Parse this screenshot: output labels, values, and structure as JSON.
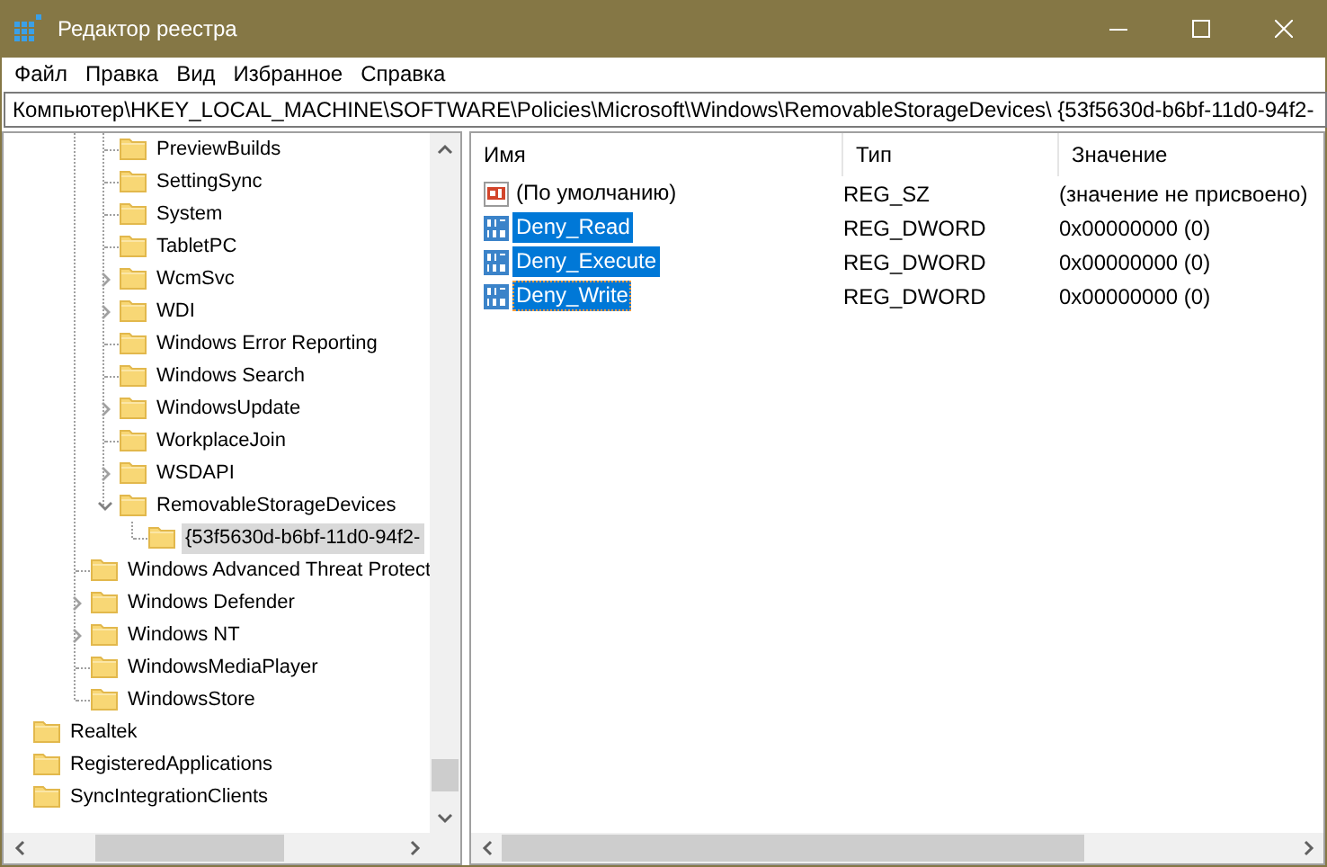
{
  "window": {
    "title": "Редактор реестра"
  },
  "menu": [
    "Файл",
    "Правка",
    "Вид",
    "Избранное",
    "Справка"
  ],
  "address": "Компьютер\\HKEY_LOCAL_MACHINE\\SOFTWARE\\Policies\\Microsoft\\Windows\\RemovableStorageDevices\\ {53f5630d-b6bf-11d0-94f2-",
  "tree": {
    "items": [
      {
        "children": [
          {
            "children": [
              {
                "children": [
                  {
                    "label": "PreviewBuilds",
                    "selected": false
                  },
                  {
                    "label": "SettingSync",
                    "selected": false
                  },
                  {
                    "label": "System",
                    "selected": false
                  },
                  {
                    "label": "TabletPC",
                    "selected": false
                  },
                  {
                    "label": "WcmSvc",
                    "selected": false,
                    "expanded": false
                  },
                  {
                    "label": "WDI",
                    "selected": false,
                    "expanded": false
                  },
                  {
                    "label": "Windows Error Reporting",
                    "selected": false
                  },
                  {
                    "label": "Windows Search",
                    "selected": false
                  },
                  {
                    "label": "WindowsUpdate",
                    "selected": false,
                    "expanded": false
                  },
                  {
                    "label": "WorkplaceJoin",
                    "selected": false
                  },
                  {
                    "label": "WSDAPI",
                    "selected": false,
                    "expanded": false
                  },
                  {
                    "label": "RemovableStorageDevices",
                    "selected": false,
                    "expanded": true,
                    "children": [
                      {
                        "label": "{53f5630d-b6bf-11d0-94f2-",
                        "selected": true
                      }
                    ]
                  }
                ]
              },
              {
                "label": "Windows Advanced Threat Protect",
                "selected": false
              },
              {
                "label": "Windows Defender",
                "selected": false,
                "expanded": false
              },
              {
                "label": "Windows NT",
                "selected": false,
                "expanded": false
              },
              {
                "label": "WindowsMediaPlayer",
                "selected": false
              },
              {
                "label": "WindowsStore",
                "selected": false
              }
            ]
          }
        ]
      },
      {
        "label": "Realtek",
        "selected": false
      },
      {
        "label": "RegisteredApplications",
        "selected": false
      },
      {
        "label": "SyncIntegrationClients",
        "selected": false
      }
    ]
  },
  "values": {
    "columns": [
      "Имя",
      "Тип",
      "Значение"
    ],
    "rows": [
      {
        "kind": "string",
        "name": "(По умолчанию)",
        "type": "REG_SZ",
        "value": "(значение не присвоено)",
        "selected": false,
        "focused": false
      },
      {
        "kind": "dword",
        "name": "Deny_Read",
        "type": "REG_DWORD",
        "value": "0x00000000 (0)",
        "selected": true,
        "focused": false
      },
      {
        "kind": "dword",
        "name": "Deny_Execute",
        "type": "REG_DWORD",
        "value": "0x00000000 (0)",
        "selected": true,
        "focused": false
      },
      {
        "kind": "dword",
        "name": "Deny_Write",
        "type": "REG_DWORD",
        "value": "0x00000000 (0)",
        "selected": true,
        "focused": true
      }
    ]
  }
}
